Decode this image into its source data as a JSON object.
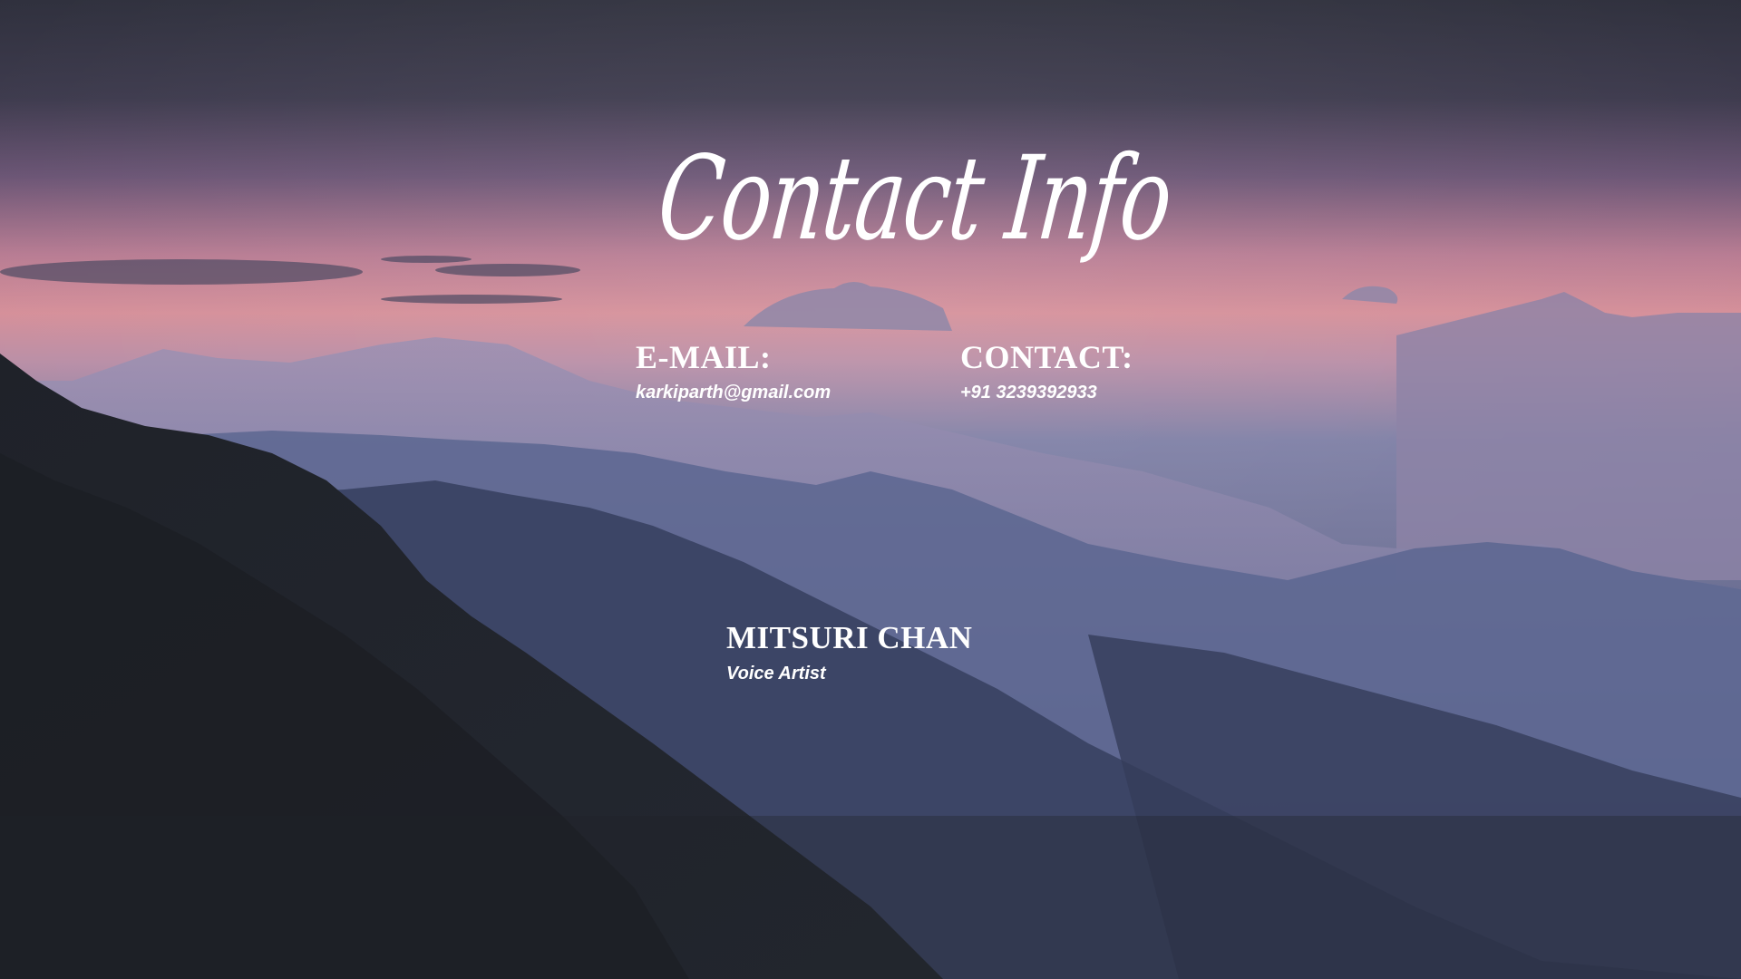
{
  "slide": {
    "title": "Contact Info",
    "email": {
      "label": "E-MAIL:",
      "value": "karkiparth@gmail.com"
    },
    "contact": {
      "label": "CONTACT:",
      "value": "+91 3239392933"
    },
    "person": {
      "name": "MITSURI CHAN",
      "role": "Voice Artist"
    }
  },
  "colors": {
    "text": "#ffffff",
    "sky_top": "#33323f",
    "sky_pink": "#d48e97",
    "mountain_mist": "#6a73a0",
    "mountain_dark": "#20232b"
  }
}
